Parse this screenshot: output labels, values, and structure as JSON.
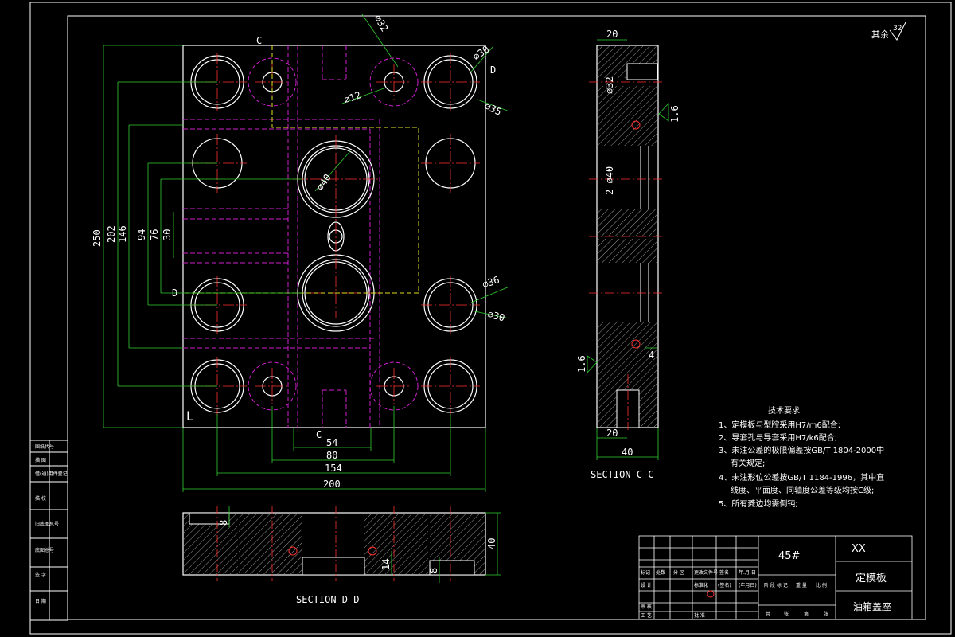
{
  "roughness": {
    "label": "其余",
    "value": "32"
  },
  "main_view": {
    "dims_vertical": [
      "250",
      "202",
      "146",
      "94",
      "76",
      "30"
    ],
    "dims_horizontal": [
      "54",
      "80",
      "154",
      "200"
    ],
    "section_marks": {
      "c": "C",
      "d": "D"
    },
    "corner_mark": "L",
    "hole_callouts": [
      "∅32",
      "∅30",
      "∅12",
      "∅35",
      "∅40",
      "∅36",
      "∅30"
    ]
  },
  "section_cc": {
    "title": "SECTION C-C",
    "dims": [
      "20",
      "∅32",
      "2-∅40",
      "20",
      "40"
    ],
    "roughness_marks": [
      "1.6",
      "1.6"
    ],
    "small_dim": "4"
  },
  "section_dd": {
    "title": "SECTION D-D",
    "dims": [
      "8",
      "40",
      "14",
      "8"
    ]
  },
  "tech_requirements": {
    "title": "技术要求",
    "lines": [
      "1、定模板与型腔采用H7/m6配合;",
      "2、导套孔与导套采用H7/k6配合;",
      "3、未注公差的极限偏差按GB/T 1804-2000中",
      "有关规定;",
      "4、未注形位公差按GB/T 1184-1996，其中直",
      "线度、平面度、同轴度公差等级均按C级;",
      "5、所有菱边均需倒钝;"
    ]
  },
  "title_block": {
    "material": "45#",
    "company": "XX",
    "part_name": "定模板",
    "assembly_name": "油箱盖座",
    "header_labels": [
      "标记",
      "处数",
      "分 区",
      "更改文件号",
      "签名",
      "年.月.日"
    ],
    "row_labels": [
      "设 计",
      "审 核",
      "工 艺"
    ],
    "std_label": "标准化",
    "sign_label": "(签名)",
    "date_label": "(年月日)",
    "approve_label": "批 准",
    "stage_labels": [
      "阶 段 标 记",
      "重 量",
      "比 例"
    ],
    "sheet_labels": [
      "共",
      "张",
      "第",
      "张"
    ]
  },
  "left_strip_labels": [
    "借(通)用件登记",
    "旧底图总号",
    "底图总号",
    "签 字",
    "日 期",
    "图纸代号",
    "描 图",
    "描 校"
  ]
}
